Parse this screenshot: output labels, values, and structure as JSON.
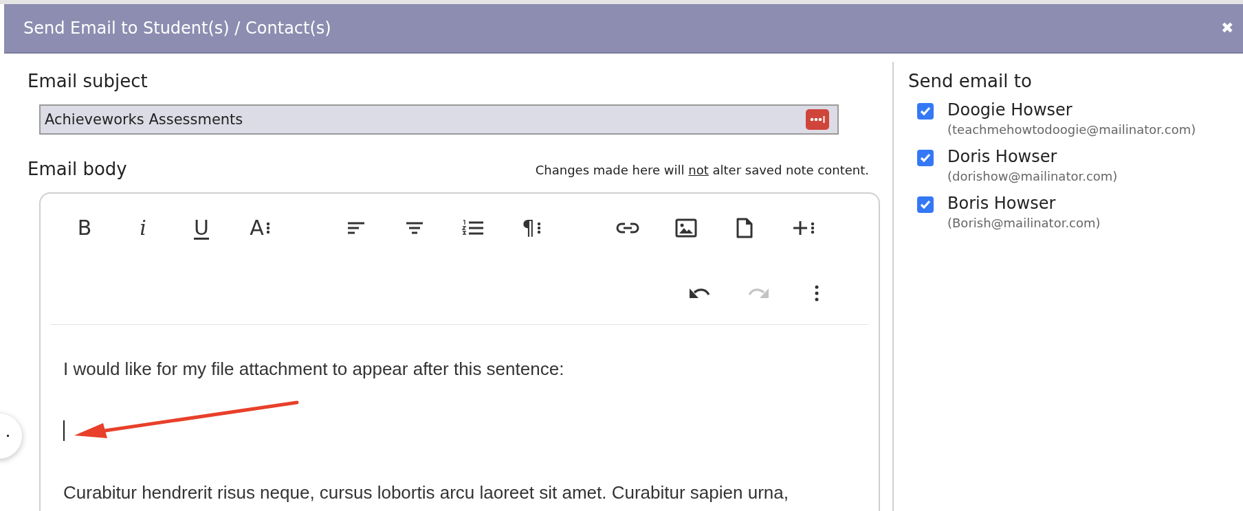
{
  "dialog": {
    "title": "Send Email to Student(s) / Contact(s)",
    "close": "✖"
  },
  "subject": {
    "label": "Email subject",
    "value": "Achieveworks Assessments"
  },
  "body": {
    "label": "Email body",
    "note": "Changes made here will ",
    "note_emphasis": "not",
    "note_rest": " alter saved note content.",
    "toolbar": [
      [
        [
          {
            "kind": "bold",
            "label": "B"
          },
          {
            "kind": "italic",
            "label": "i"
          },
          {
            "kind": "underline",
            "label": "U"
          },
          {
            "kind": "font",
            "label": "A"
          }
        ],
        [
          {
            "kind": "align-left"
          },
          {
            "kind": "align-center"
          },
          {
            "kind": "ordered-list"
          },
          {
            "kind": "paragraph",
            "label": "¶"
          }
        ],
        [
          {
            "kind": "link"
          },
          {
            "kind": "image"
          },
          {
            "kind": "file"
          },
          {
            "kind": "insert"
          }
        ]
      ],
      [
        [
          {
            "kind": "undo",
            "disabled": false
          },
          {
            "kind": "redo",
            "disabled": true
          },
          {
            "kind": "more"
          }
        ]
      ]
    ],
    "paragraphs": [
      "I would like for my file attachment to appear after this sentence:",
      "Curabitur hendrerit risus neque, cursus lobortis arcu laoreet sit amet. Curabitur sapien urna,"
    ]
  },
  "recipients": {
    "label": "Send email to",
    "items": [
      {
        "name": "Doogie Howser",
        "email": "(teachmehowtodoogie@mailinator.com)",
        "checked": true
      },
      {
        "name": "Doris Howser",
        "email": "(dorishow@mailinator.com)",
        "checked": true
      },
      {
        "name": "Boris Howser",
        "email": "(Borish@mailinator.com)",
        "checked": true
      }
    ]
  }
}
